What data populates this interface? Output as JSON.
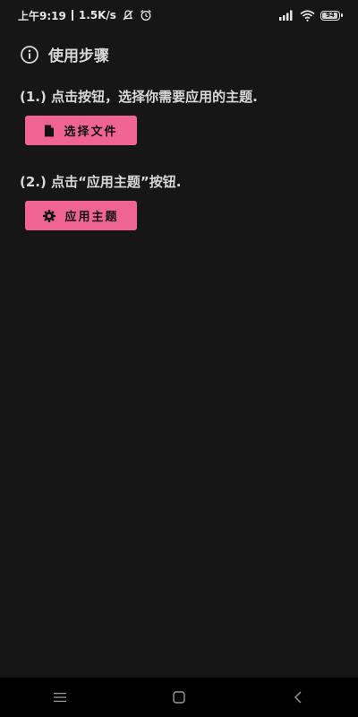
{
  "status_bar": {
    "time": "上午9:19",
    "speed": "1.5K/s",
    "battery": "94",
    "icons": [
      "no-notification-icon",
      "alarm-icon",
      "signal-icon",
      "wifi-icon",
      "battery-icon"
    ]
  },
  "section": {
    "icon": "info-icon",
    "title": "使用步骤"
  },
  "steps": [
    {
      "text": "(1.) 点击按钮，选择你需要应用的主题.",
      "button": {
        "label": "选择文件",
        "icon": "file-icon"
      }
    },
    {
      "text": "(2.) 点击“应用主题”按钮.",
      "button": {
        "label": "应用主题",
        "icon": "gear-icon"
      }
    }
  ],
  "nav_bar": {
    "icons": [
      "menu-icon",
      "home-icon",
      "back-icon"
    ]
  },
  "colors": {
    "background": "#161616",
    "accent": "#f06494",
    "text": "#d9d9d9",
    "nav_background": "#000000"
  }
}
